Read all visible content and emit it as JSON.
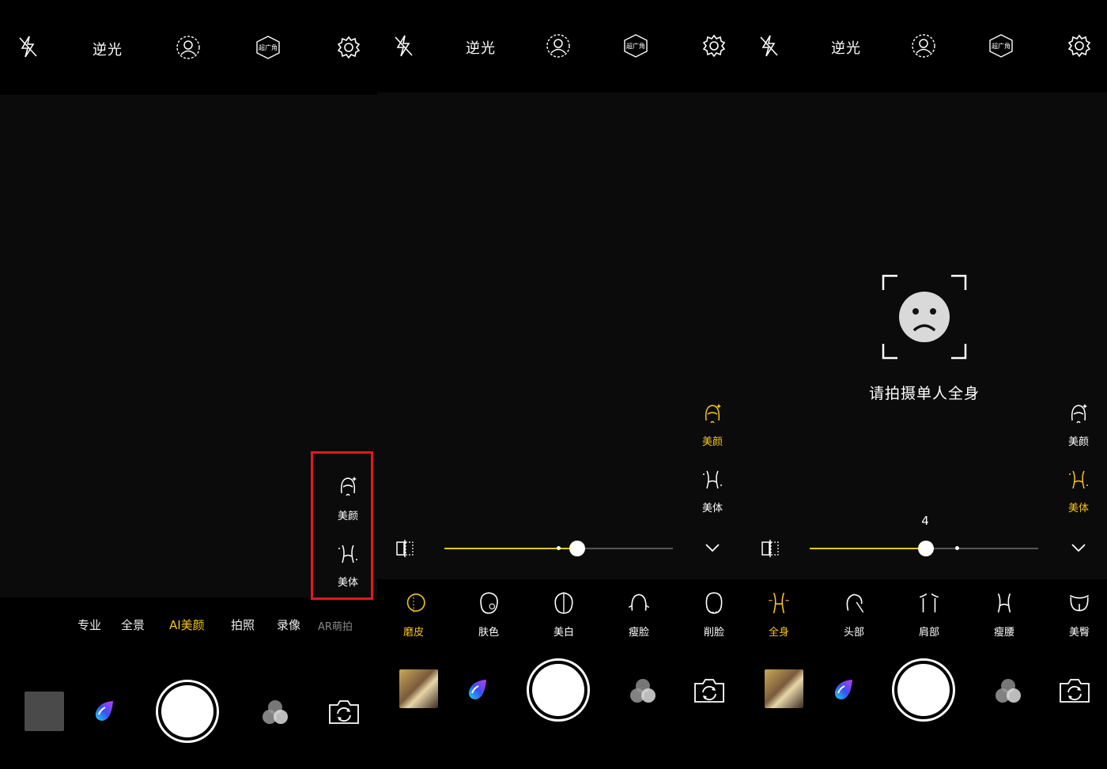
{
  "top_bar": {
    "flash_icon": "flash-off-icon",
    "backlight_label": "逆光",
    "portrait_icon": "portrait-icon",
    "wide_angle_label": "超广角",
    "settings_icon": "gear-icon"
  },
  "side_menu": {
    "beauty_label": "美颜",
    "body_label": "美体"
  },
  "modes": [
    "专业",
    "全景",
    "AI美颜",
    "拍照",
    "录像",
    "AR萌拍"
  ],
  "active_mode": "AI美颜",
  "panel2": {
    "slider_value": 0.58,
    "tools": [
      {
        "label": "磨皮",
        "active": true
      },
      {
        "label": "肤色",
        "active": false
      },
      {
        "label": "美白",
        "active": false
      },
      {
        "label": "瘦脸",
        "active": false
      },
      {
        "label": "削脸",
        "active": false
      }
    ]
  },
  "panel3": {
    "prompt": "请拍摄单人全身",
    "slider_label": "4",
    "slider_value": 0.51,
    "tools": [
      {
        "label": "全身",
        "active": true
      },
      {
        "label": "头部",
        "active": false
      },
      {
        "label": "肩部",
        "active": false
      },
      {
        "label": "瘦腰",
        "active": false
      },
      {
        "label": "美臀",
        "active": false
      }
    ]
  },
  "colors": {
    "accent": "#f5c518",
    "highlight_box": "#e0191d"
  }
}
